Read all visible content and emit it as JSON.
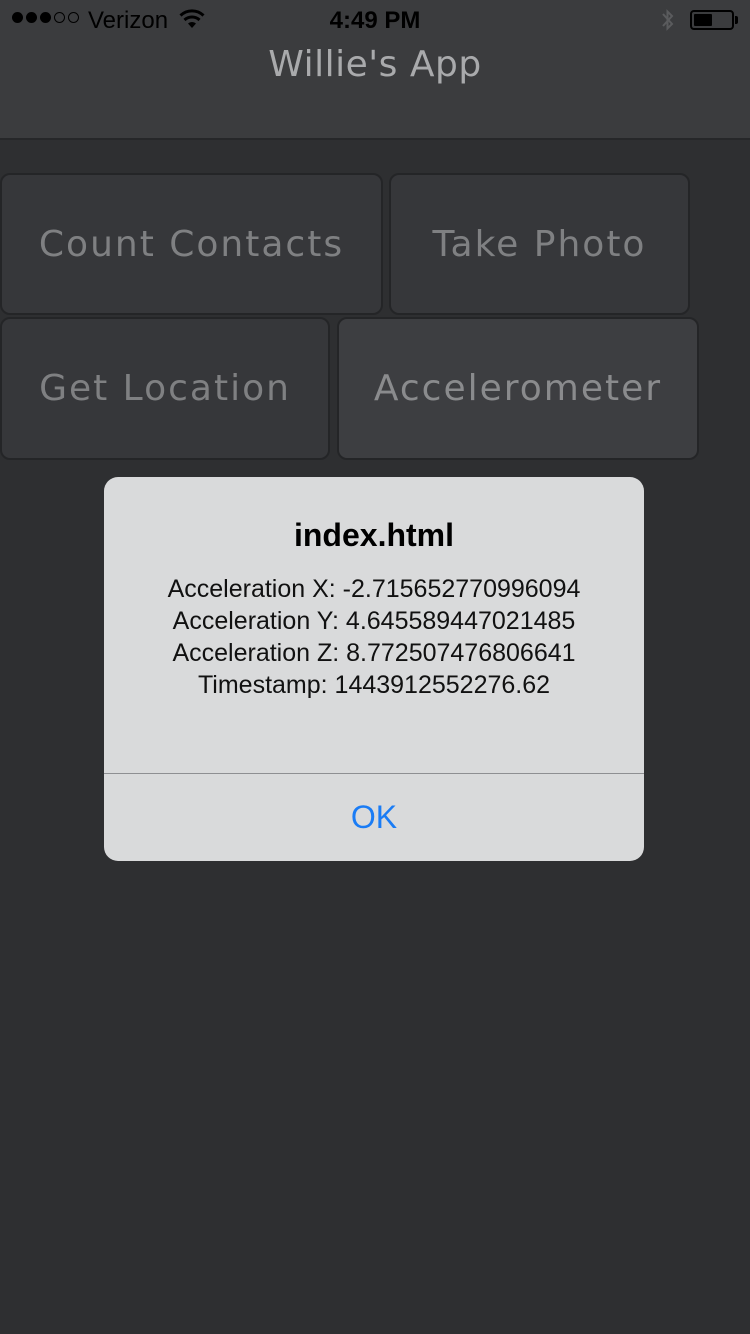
{
  "status_bar": {
    "carrier": "Verizon",
    "time": "4:49 PM",
    "signal_bars_filled": 3,
    "signal_bars_total": 5,
    "battery_level": 0.5,
    "wifi_icon": "wifi-icon",
    "bluetooth_icon": "bluetooth-icon"
  },
  "header": {
    "title": "Willie's App"
  },
  "buttons": {
    "count_contacts": "Count Contacts",
    "take_photo": "Take Photo",
    "get_location": "Get Location",
    "accelerometer": "Accelerometer"
  },
  "alert": {
    "title": "index.html",
    "lines": [
      "Acceleration X: -2.715652770996094",
      "Acceleration Y: 4.645589447021485",
      "Acceleration Z: 8.772507476806641",
      "Timestamp: 1443912552276.62"
    ],
    "ok_label": "OK"
  },
  "colors": {
    "background": "#2e2f31",
    "alert_background": "#d9dadb",
    "ok_blue": "#1a7cf5"
  }
}
